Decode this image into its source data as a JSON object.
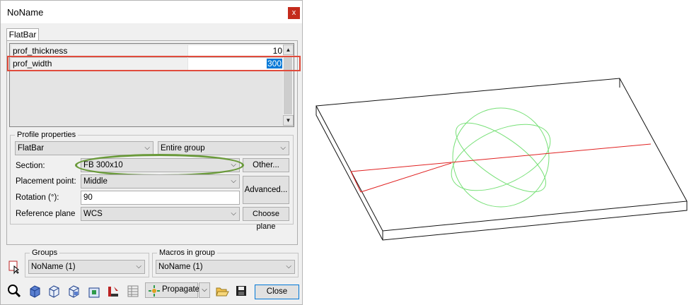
{
  "window": {
    "title": "NoName",
    "close_label": "x"
  },
  "tab": {
    "label": "FlatBar"
  },
  "properties": [
    {
      "name": "prof_thickness",
      "value": "10"
    },
    {
      "name": "prof_width",
      "value": "300"
    }
  ],
  "profile_properties": {
    "group_label": "Profile properties",
    "type_value": "FlatBar",
    "scope_value": "Entire group",
    "section_label": "Section:",
    "section_value": "FB 300x10",
    "other_button": "Other...",
    "placement_label": "Placement point:",
    "placement_value": "Middle",
    "advanced_button": "Advanced...",
    "rotation_label": "Rotation (°):",
    "rotation_value": "90",
    "refplane_label": "Reference plane",
    "refplane_value": "WCS",
    "choose_plane_button": "Choose plane"
  },
  "groups": {
    "label": "Groups",
    "value": "NoName (1)"
  },
  "macros": {
    "label": "Macros in group",
    "value": "NoName (1)"
  },
  "toolbar": {
    "propagate_label": "Propagate",
    "close_label": "Close"
  },
  "colors": {
    "highlight_box": "#e04b3c",
    "section_oval": "#6a9a3a",
    "selection": "#0078d7",
    "model_axis": "#e02020",
    "sphere": "#77e077"
  }
}
